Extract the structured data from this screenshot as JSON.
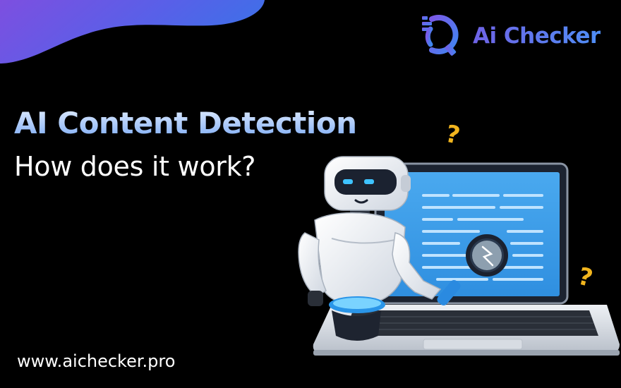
{
  "brand": {
    "name": "Ai Checker",
    "logo_icon": "search-document-icon",
    "colors": {
      "purple": "#6f63e6",
      "blue": "#4f8ef5"
    }
  },
  "hero": {
    "title": "AI Content Detection",
    "subtitle": "How does it work?"
  },
  "footer": {
    "website": "www.aichecker.pro"
  },
  "illustration": {
    "subject": "robot-with-laptop",
    "decorations": [
      "question-mark-icon",
      "question-mark-icon"
    ]
  }
}
